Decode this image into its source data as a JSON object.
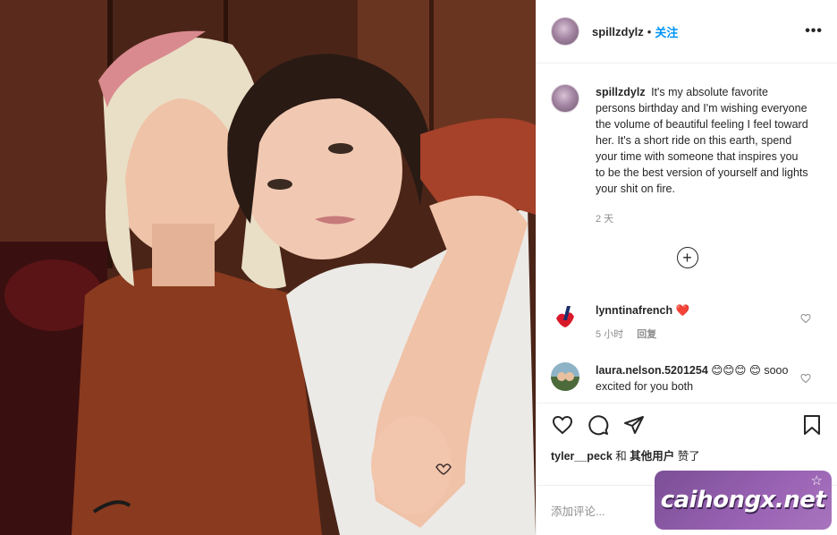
{
  "post": {
    "username": "spillzdylz",
    "dot": "•",
    "follow_label": "关注",
    "more_label": "•••"
  },
  "caption": {
    "username": "spillzdylz",
    "text": "It's my absolute favorite persons birthday and I'm wishing everyone the volume of beautiful feeling I feel toward her. It's a short ride on this earth, spend your time with someone that inspires you to be the best version of yourself and lights your shit on fire.",
    "time": "2 天"
  },
  "load_more": {
    "icon": "plus-circle-icon",
    "symbol": "+"
  },
  "comments": [
    {
      "username": "lynntinafrench",
      "text": "❤️",
      "time": "5 小时",
      "reply_label": "回复"
    },
    {
      "username": "laura.nelson.5201254",
      "text": "😊😊😊 😊 sooo excited for you both",
      "time": "",
      "reply_label": ""
    }
  ],
  "actions": {
    "like_icon": "heart-icon",
    "comment_icon": "comment-icon",
    "share_icon": "send-icon",
    "save_icon": "bookmark-icon"
  },
  "likes": {
    "user": "tyler__peck",
    "and": " 和 ",
    "others": "其他用户",
    "suffix": " 赞了"
  },
  "add_comment": {
    "placeholder": "添加评论..."
  },
  "watermark": {
    "text": "caihongx.net",
    "star": "☆"
  },
  "colors": {
    "link_blue": "#0095f6",
    "heart_red": "#ed4956",
    "watermark_purple": "#8a5aa6"
  }
}
